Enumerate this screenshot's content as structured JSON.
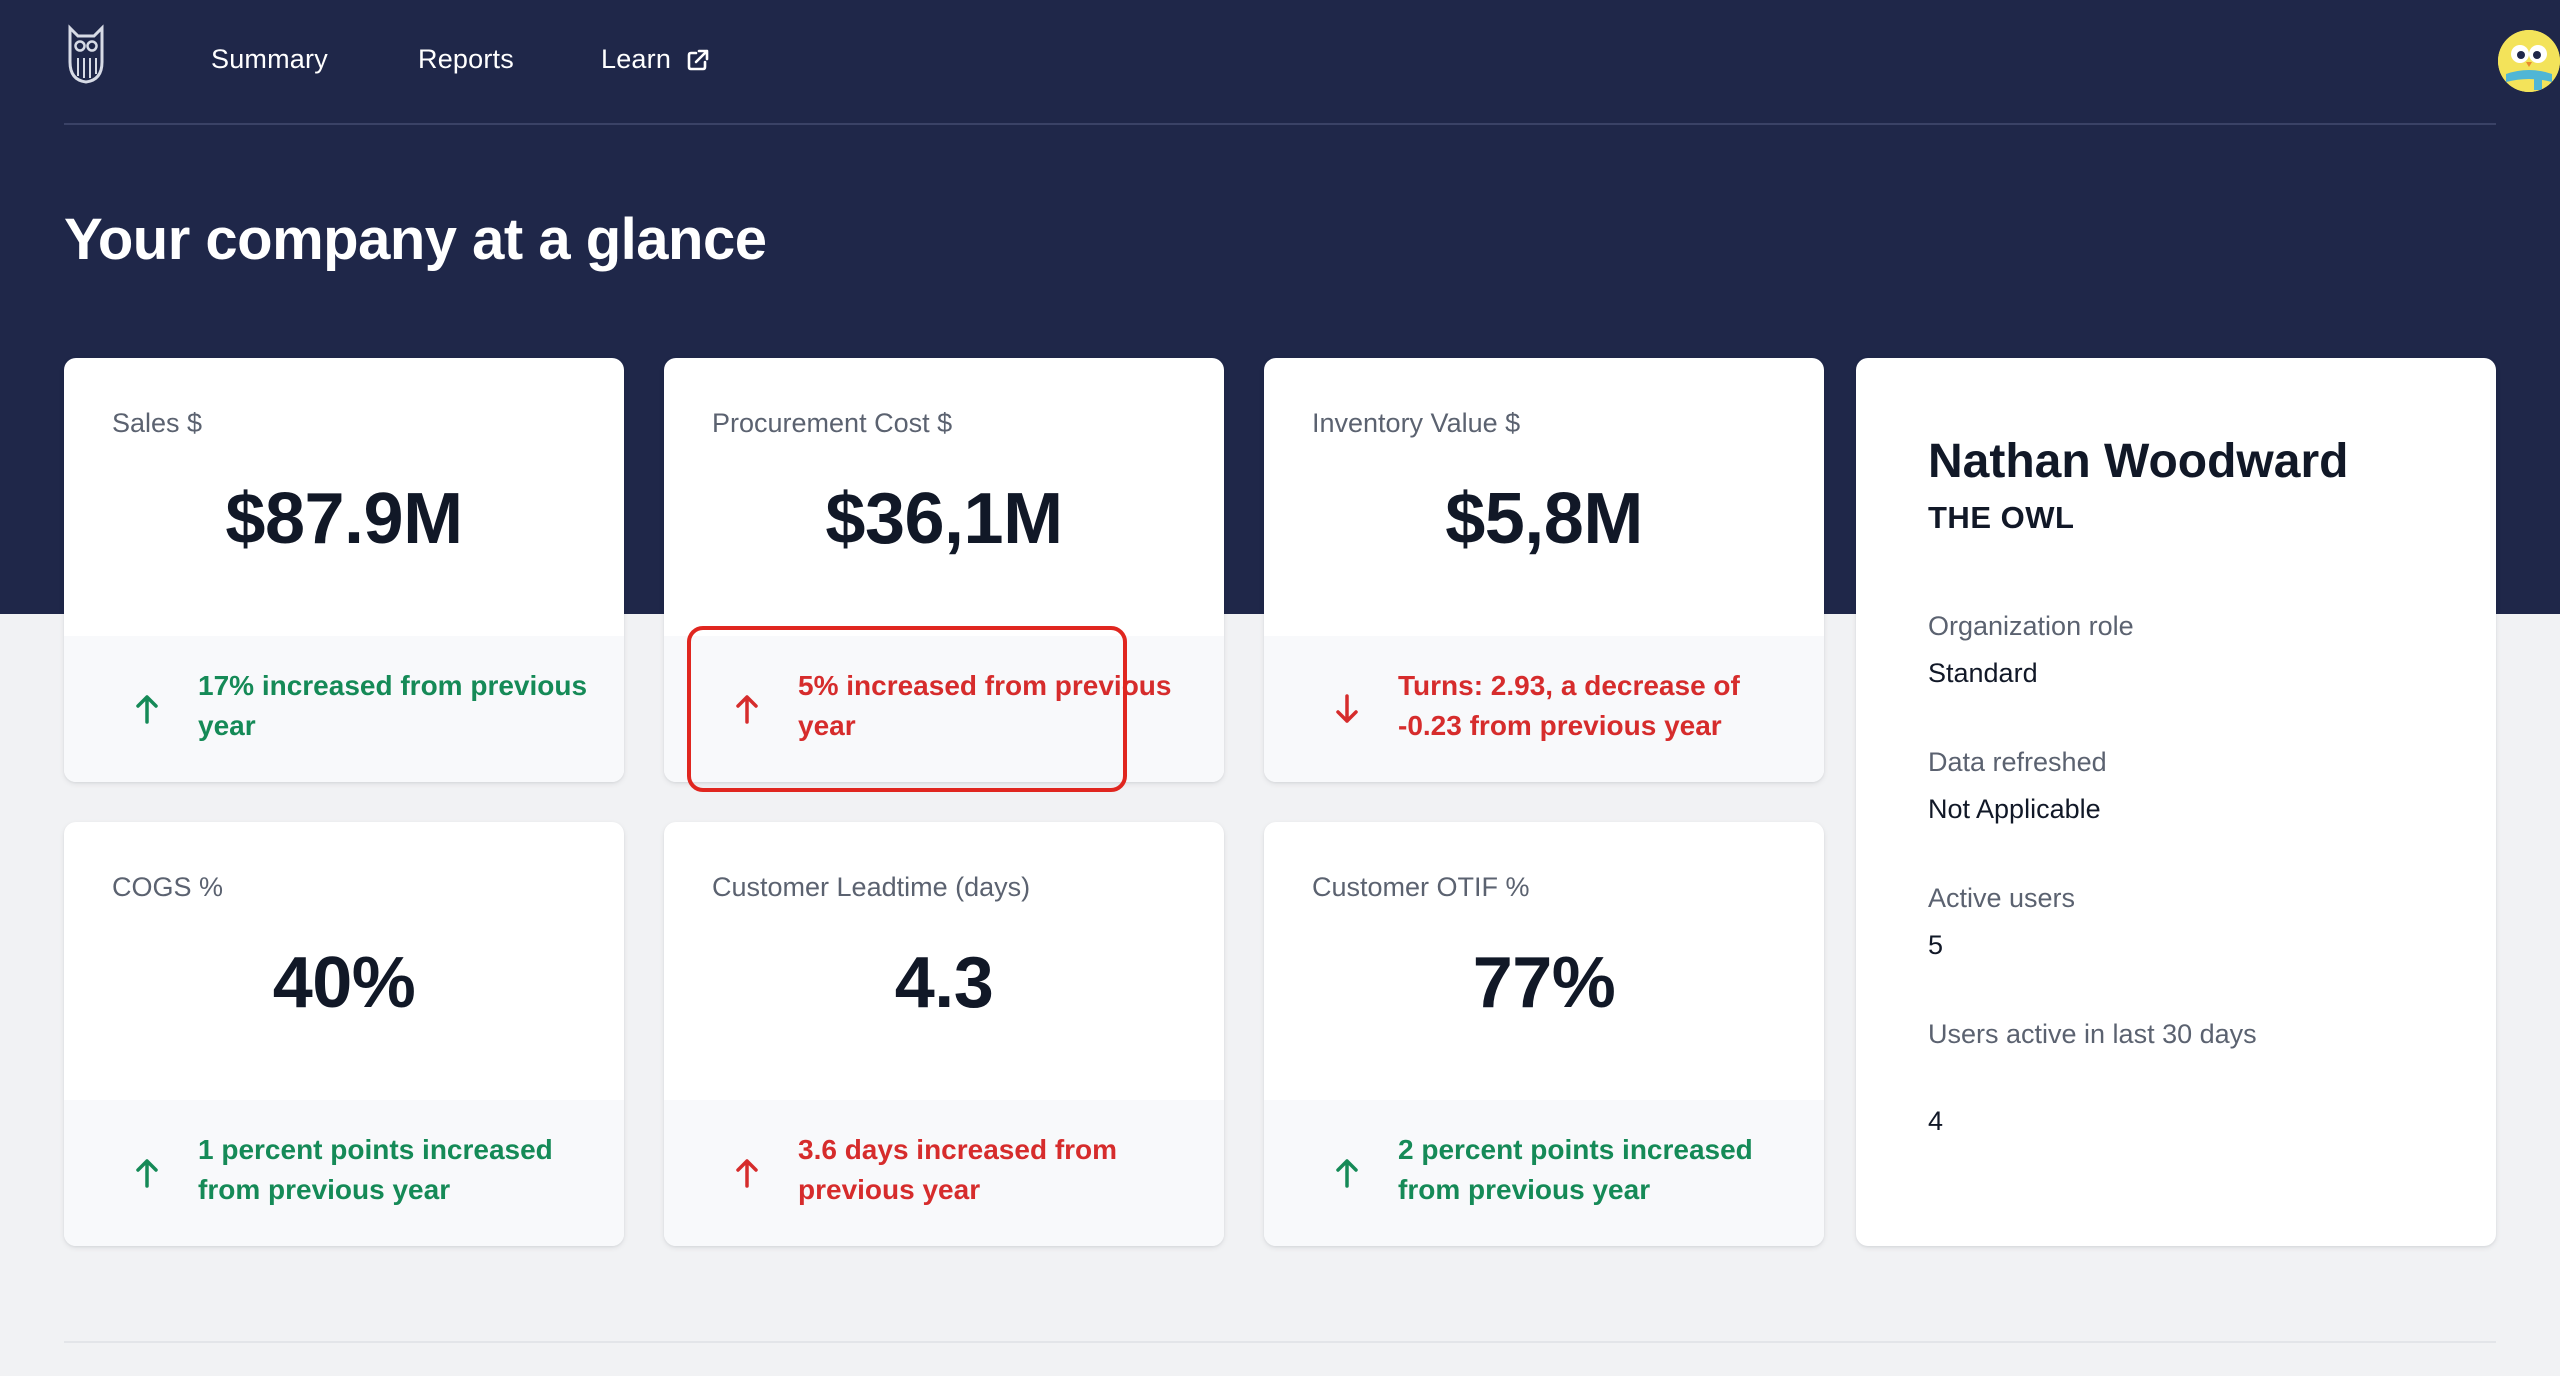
{
  "nav": {
    "summary": "Summary",
    "reports": "Reports",
    "learn": "Learn"
  },
  "page": {
    "title": "Your company at a glance"
  },
  "cards": [
    {
      "label": "Sales $",
      "value": "$87.9M",
      "trend": "17% increased from previous year",
      "direction": "up",
      "status": "positive"
    },
    {
      "label": "Procurement Cost $",
      "value": "$36,1M",
      "trend": "5% increased from previous year",
      "direction": "up",
      "status": "negative"
    },
    {
      "label": "Inventory Value $",
      "value": "$5,8M",
      "trend": "Turns: 2.93, a decrease of -0.23 from previous year",
      "direction": "down",
      "status": "negative"
    },
    {
      "label": "COGS %",
      "value": "40%",
      "trend": "1 percent points increased from previous year",
      "direction": "up",
      "status": "positive"
    },
    {
      "label": "Customer Leadtime (days)",
      "value": "4.3",
      "trend": "3.6 days increased from previous year",
      "direction": "up",
      "status": "negative"
    },
    {
      "label": "Customer OTIF %",
      "value": "77%",
      "trend": "2 percent points increased from previous year",
      "direction": "up",
      "status": "positive"
    }
  ],
  "profile": {
    "name": "Nathan Woodward",
    "subtitle": "THE OWL",
    "fields": [
      {
        "label": "Organization role",
        "value": "Standard"
      },
      {
        "label": "Data refreshed",
        "value": "Not Applicable"
      },
      {
        "label": "Active users",
        "value": "5"
      },
      {
        "label": "Users active in last 30 days",
        "value": "4"
      }
    ]
  },
  "colors": {
    "header_bg": "#1f2749",
    "positive": "#158a57",
    "negative": "#d62c2c",
    "highlight": "#e0261f"
  },
  "icons": {
    "logo": "owl-logo-icon",
    "external": "external-link-icon",
    "avatar": "owl-avatar-icon"
  }
}
